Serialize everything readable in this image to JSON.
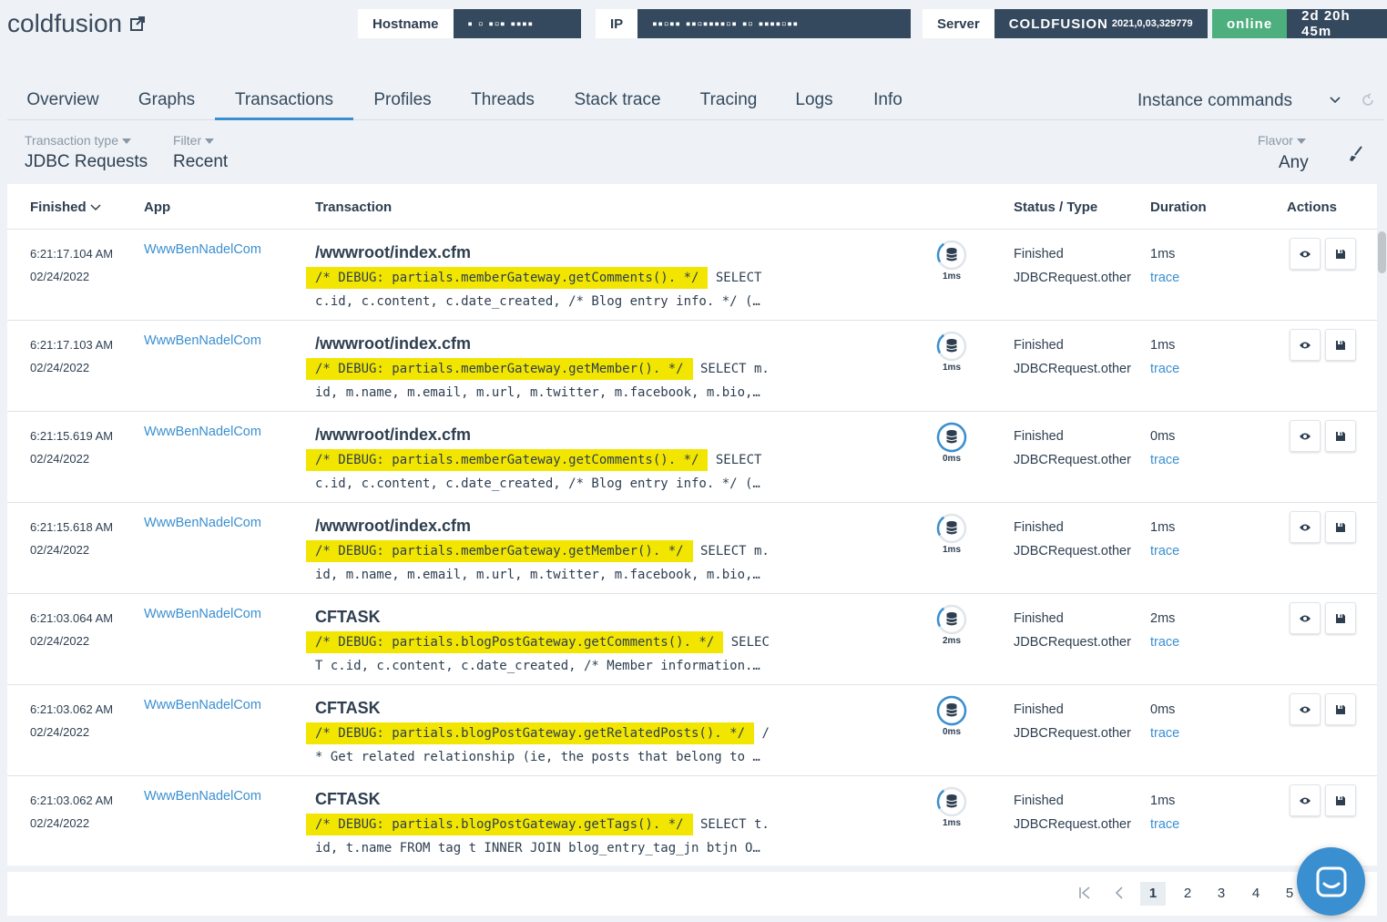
{
  "header": {
    "title": "coldfusion",
    "hostname_label": "Hostname",
    "hostname_value": "▪ ▫ ▪▫▪ ▪▪▪▪",
    "ip_label": "IP",
    "ip_value": "▪▪▫▪▪ ▪▪▫▪▪▪▪▫▪ ▪▫ ▪▪▪▪▫▪▪",
    "server_label": "Server",
    "server_name": "COLDFUSION",
    "server_version": "2021,0,03,329779",
    "status": "online",
    "uptime": "2d 20h 45m"
  },
  "tabs": [
    {
      "label": "Overview"
    },
    {
      "label": "Graphs"
    },
    {
      "label": "Transactions"
    },
    {
      "label": "Profiles"
    },
    {
      "label": "Threads"
    },
    {
      "label": "Stack trace"
    },
    {
      "label": "Tracing"
    },
    {
      "label": "Logs"
    },
    {
      "label": "Info"
    }
  ],
  "active_tab": "Transactions",
  "instance_commands": "Instance commands",
  "filters": {
    "type_label": "Transaction type",
    "type_value": "JDBC Requests",
    "filter_label": "Filter",
    "filter_value": "Recent",
    "flavor_label": "Flavor",
    "flavor_value": "Any"
  },
  "columns": {
    "finished": "Finished",
    "app": "App",
    "transaction": "Transaction",
    "status_type": "Status / Type",
    "duration": "Duration",
    "actions": "Actions"
  },
  "rows": [
    {
      "time": "6:21:17.104 AM",
      "date": "02/24/2022",
      "app": "WwwBenNadelCom",
      "tx": "/wwwroot/index.cfm",
      "debug": "/* DEBUG: partials.memberGateway.getComments(). */",
      "sql1": " SELECT",
      "sql2": "c.id, c.content, c.date_created, /* Blog entry info. */ (…",
      "db_ms": "1ms",
      "db_fill": 0.1,
      "status": "Finished",
      "type": "JDBCRequest.other",
      "duration": "1ms",
      "trace": "trace"
    },
    {
      "time": "6:21:17.103 AM",
      "date": "02/24/2022",
      "app": "WwwBenNadelCom",
      "tx": "/wwwroot/index.cfm",
      "debug": "/* DEBUG: partials.memberGateway.getMember(). */",
      "sql1": " SELECT m.",
      "sql2": "id, m.name, m.email, m.url, m.twitter, m.facebook, m.bio,…",
      "db_ms": "1ms",
      "db_fill": 0.1,
      "status": "Finished",
      "type": "JDBCRequest.other",
      "duration": "1ms",
      "trace": "trace"
    },
    {
      "time": "6:21:15.619 AM",
      "date": "02/24/2022",
      "app": "WwwBenNadelCom",
      "tx": "/wwwroot/index.cfm",
      "debug": "/* DEBUG: partials.memberGateway.getComments(). */",
      "sql1": " SELECT",
      "sql2": "c.id, c.content, c.date_created, /* Blog entry info. */ (…",
      "db_ms": "0ms",
      "db_fill": 1.0,
      "status": "Finished",
      "type": "JDBCRequest.other",
      "duration": "0ms",
      "trace": "trace"
    },
    {
      "time": "6:21:15.618 AM",
      "date": "02/24/2022",
      "app": "WwwBenNadelCom",
      "tx": "/wwwroot/index.cfm",
      "debug": "/* DEBUG: partials.memberGateway.getMember(). */",
      "sql1": " SELECT m.",
      "sql2": "id, m.name, m.email, m.url, m.twitter, m.facebook, m.bio,…",
      "db_ms": "1ms",
      "db_fill": 0.1,
      "status": "Finished",
      "type": "JDBCRequest.other",
      "duration": "1ms",
      "trace": "trace"
    },
    {
      "time": "6:21:03.064 AM",
      "date": "02/24/2022",
      "app": "WwwBenNadelCom",
      "tx": "CFTASK",
      "debug": "/* DEBUG: partials.blogPostGateway.getComments(). */",
      "sql1": " SELEC",
      "sql2": "T c.id, c.content, c.date_created, /* Member information.…",
      "db_ms": "2ms",
      "db_fill": 0.1,
      "status": "Finished",
      "type": "JDBCRequest.other",
      "duration": "2ms",
      "trace": "trace"
    },
    {
      "time": "6:21:03.062 AM",
      "date": "02/24/2022",
      "app": "WwwBenNadelCom",
      "tx": "CFTASK",
      "debug": "/* DEBUG: partials.blogPostGateway.getRelatedPosts(). */",
      "sql1": " /",
      "sql2": "* Get related relationship (ie, the posts that belong to …",
      "db_ms": "0ms",
      "db_fill": 1.0,
      "status": "Finished",
      "type": "JDBCRequest.other",
      "duration": "0ms",
      "trace": "trace"
    },
    {
      "time": "6:21:03.062 AM",
      "date": "02/24/2022",
      "app": "WwwBenNadelCom",
      "tx": "CFTASK",
      "debug": "/* DEBUG: partials.blogPostGateway.getTags(). */",
      "sql1": " SELECT t.",
      "sql2": "id, t.name FROM tag t INNER JOIN blog_entry_tag_jn btjn O…",
      "db_ms": "1ms",
      "db_fill": 0.1,
      "status": "Finished",
      "type": "JDBCRequest.other",
      "duration": "1ms",
      "trace": "trace"
    }
  ],
  "pagination": {
    "pages": [
      "1",
      "2",
      "3",
      "4",
      "5"
    ],
    "current": "1"
  },
  "colors": {
    "accent": "#3a8fd0",
    "online": "#4caf7d",
    "highlight": "#f2e600",
    "dark": "#34495e"
  }
}
